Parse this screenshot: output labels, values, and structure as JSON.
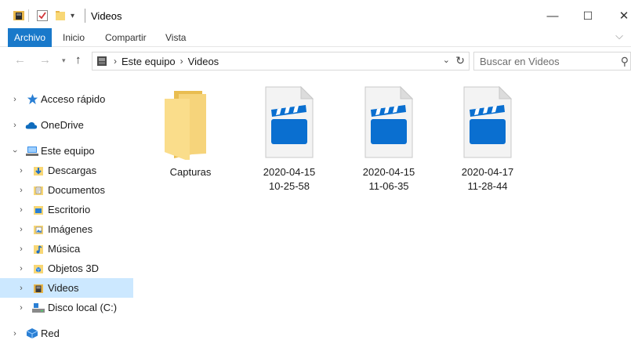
{
  "window": {
    "title": "Videos",
    "controls": {
      "minimize": "—",
      "maximize": "☐",
      "close": "✕"
    }
  },
  "ribbon": {
    "tabs": [
      {
        "label": "Archivo",
        "active": true
      },
      {
        "label": "Inicio",
        "active": false
      },
      {
        "label": "Compartir",
        "active": false
      },
      {
        "label": "Vista",
        "active": false
      }
    ]
  },
  "address": {
    "breadcrumbs": [
      "Este equipo",
      "Videos"
    ],
    "search_placeholder": "Buscar en Videos"
  },
  "nav": {
    "items": [
      {
        "label": "Acceso rápido",
        "icon": "star-icon",
        "level": 0,
        "expanded": false,
        "selected": false
      },
      {
        "label": "OneDrive",
        "icon": "cloud-icon",
        "level": 0,
        "expanded": false,
        "selected": false
      },
      {
        "label": "Este equipo",
        "icon": "computer-icon",
        "level": 0,
        "expanded": true,
        "selected": false
      },
      {
        "label": "Descargas",
        "icon": "download-folder-icon",
        "level": 1,
        "expanded": false,
        "selected": false
      },
      {
        "label": "Documentos",
        "icon": "documents-folder-icon",
        "level": 1,
        "expanded": false,
        "selected": false
      },
      {
        "label": "Escritorio",
        "icon": "desktop-folder-icon",
        "level": 1,
        "expanded": false,
        "selected": false
      },
      {
        "label": "Imágenes",
        "icon": "pictures-folder-icon",
        "level": 1,
        "expanded": false,
        "selected": false
      },
      {
        "label": "Música",
        "icon": "music-folder-icon",
        "level": 1,
        "expanded": false,
        "selected": false
      },
      {
        "label": "Objetos 3D",
        "icon": "3d-objects-folder-icon",
        "level": 1,
        "expanded": false,
        "selected": false
      },
      {
        "label": "Videos",
        "icon": "videos-folder-icon",
        "level": 1,
        "expanded": false,
        "selected": true
      },
      {
        "label": "Disco local (C:)",
        "icon": "drive-icon",
        "level": 1,
        "expanded": false,
        "selected": false
      },
      {
        "label": "Red",
        "icon": "network-icon",
        "level": 0,
        "expanded": false,
        "selected": false
      }
    ]
  },
  "files": [
    {
      "name_line1": "Capturas",
      "name_line2": "",
      "type": "folder"
    },
    {
      "name_line1": "2020-04-15",
      "name_line2": "10-25-58",
      "type": "video"
    },
    {
      "name_line1": "2020-04-15",
      "name_line2": "11-06-35",
      "type": "video"
    },
    {
      "name_line1": "2020-04-17",
      "name_line2": "11-28-44",
      "type": "video"
    }
  ],
  "colors": {
    "accent": "#1979ca",
    "selection": "#cce8ff",
    "folder": "#f8d775",
    "video_blue": "#0a6fd0"
  }
}
